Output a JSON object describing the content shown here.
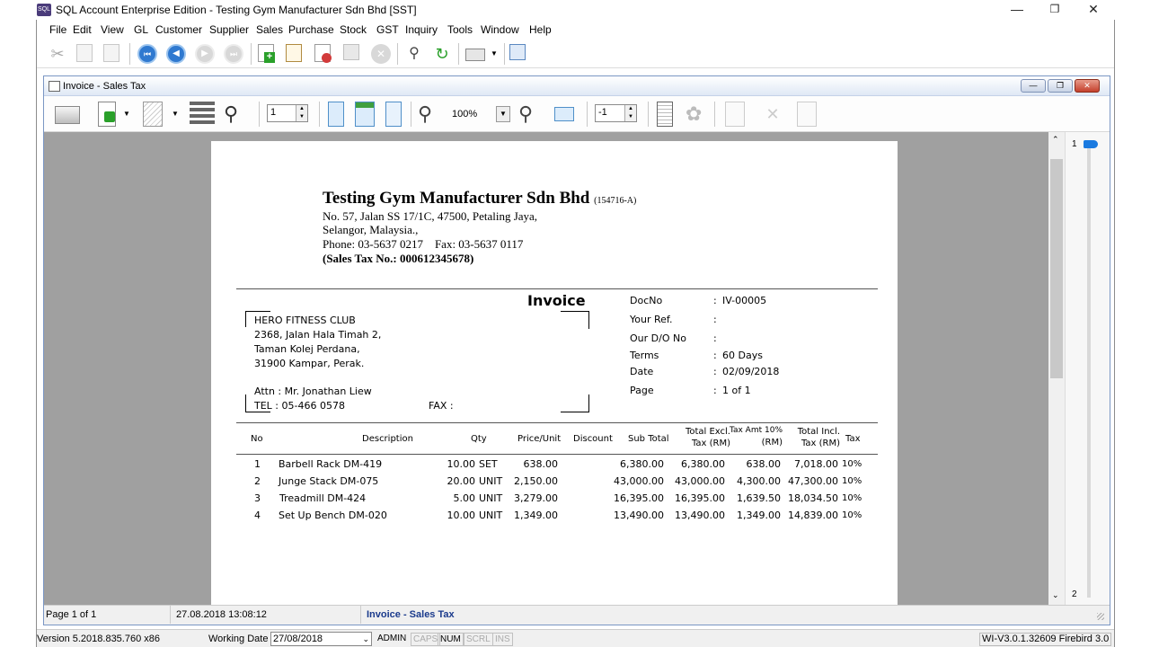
{
  "app": {
    "title": "SQL Account Enterprise Edition - Testing Gym Manufacturer Sdn Bhd [SST]",
    "icon": "sql-account-icon"
  },
  "menu": [
    "File",
    "Edit",
    "View",
    "GL",
    "Customer",
    "Supplier",
    "Sales",
    "Purchase",
    "Stock",
    "GST",
    "Inquiry",
    "Tools",
    "Window",
    "Help"
  ],
  "child": {
    "title": "Invoice - Sales Tax",
    "zoom": "100%",
    "page_spin": "1",
    "page_spin2": "-1"
  },
  "thumbs": {
    "p1": "1",
    "p2": "2"
  },
  "company": {
    "name": "Testing Gym Manufacturer Sdn Bhd",
    "reg": "(154716-A)",
    "addr1": "No. 57, Jalan SS 17/1C, 47500, Petaling Jaya,",
    "addr2": "Selangor, Malaysia.,",
    "phone": "Phone: 03-5637 0217    Fax: 03-5637 0117",
    "sst": "(Sales Tax No.: 000612345678)"
  },
  "doc": {
    "heading": "Invoice",
    "fields": [
      {
        "label": "DocNo",
        "value": "IV-00005"
      },
      {
        "label": "Your Ref.",
        "value": ""
      },
      {
        "label": "Our D/O No",
        "value": ""
      },
      {
        "label": "Terms",
        "value": "60 Days"
      },
      {
        "label": "Date",
        "value": "02/09/2018"
      },
      {
        "label": "Page",
        "value": "1 of 1"
      }
    ]
  },
  "customer": {
    "name": "HERO FITNESS CLUB",
    "addr1": "2368, Jalan Hala Timah 2,",
    "addr2": "Taman Kolej Perdana,",
    "addr3": "31900 Kampar, Perak.",
    "attn": "Attn : Mr. Jonathan Liew",
    "tel": "TEL : 05-466 0578",
    "fax": "FAX :"
  },
  "table": {
    "headers": {
      "no": "No",
      "desc": "Description",
      "qty": "Qty",
      "price": "Price/Unit",
      "discount": "Discount",
      "subtotal": "Sub Total",
      "excl1": "Total Excl.",
      "excl2": "Tax (RM)",
      "taxamt1": "Tax Amt 10%",
      "taxamt2": "(RM)",
      "incl1": "Total Incl.",
      "incl2": "Tax (RM)",
      "tax": "Tax"
    },
    "rows": [
      {
        "no": "1",
        "desc": "Barbell Rack DM-419",
        "qty": "10.00",
        "uom": "SET",
        "price": "638.00",
        "subtotal": "6,380.00",
        "excl": "6,380.00",
        "taxamt": "638.00",
        "incl": "7,018.00",
        "tax": "10%"
      },
      {
        "no": "2",
        "desc": "Junge Stack DM-075",
        "qty": "20.00",
        "uom": "UNIT",
        "price": "2,150.00",
        "subtotal": "43,000.00",
        "excl": "43,000.00",
        "taxamt": "4,300.00",
        "incl": "47,300.00",
        "tax": "10%"
      },
      {
        "no": "3",
        "desc": "Treadmill DM-424",
        "qty": "5.00",
        "uom": "UNIT",
        "price": "3,279.00",
        "subtotal": "16,395.00",
        "excl": "16,395.00",
        "taxamt": "1,639.50",
        "incl": "18,034.50",
        "tax": "10%"
      },
      {
        "no": "4",
        "desc": "Set Up Bench DM-020",
        "qty": "10.00",
        "uom": "UNIT",
        "price": "1,349.00",
        "subtotal": "13,490.00",
        "excl": "13,490.00",
        "taxamt": "1,349.00",
        "incl": "14,839.00",
        "tax": "10%"
      }
    ]
  },
  "preview_status": {
    "page": "Page 1 of 1",
    "datetime": "27.08.2018 13:08:12",
    "report": "Invoice - Sales Tax"
  },
  "status": {
    "version": "Version 5.2018.835.760 x86",
    "working_date_label": "Working Date",
    "working_date": "27/08/2018",
    "user": "ADMIN",
    "caps": "CAPS",
    "num": "NUM",
    "scrl": "SCRL",
    "ins": "INS",
    "build": "WI-V3.0.1.32609 Firebird 3.0"
  },
  "colors": {
    "accent": "#1f4fa0",
    "report_label": "#1a3a8c"
  }
}
